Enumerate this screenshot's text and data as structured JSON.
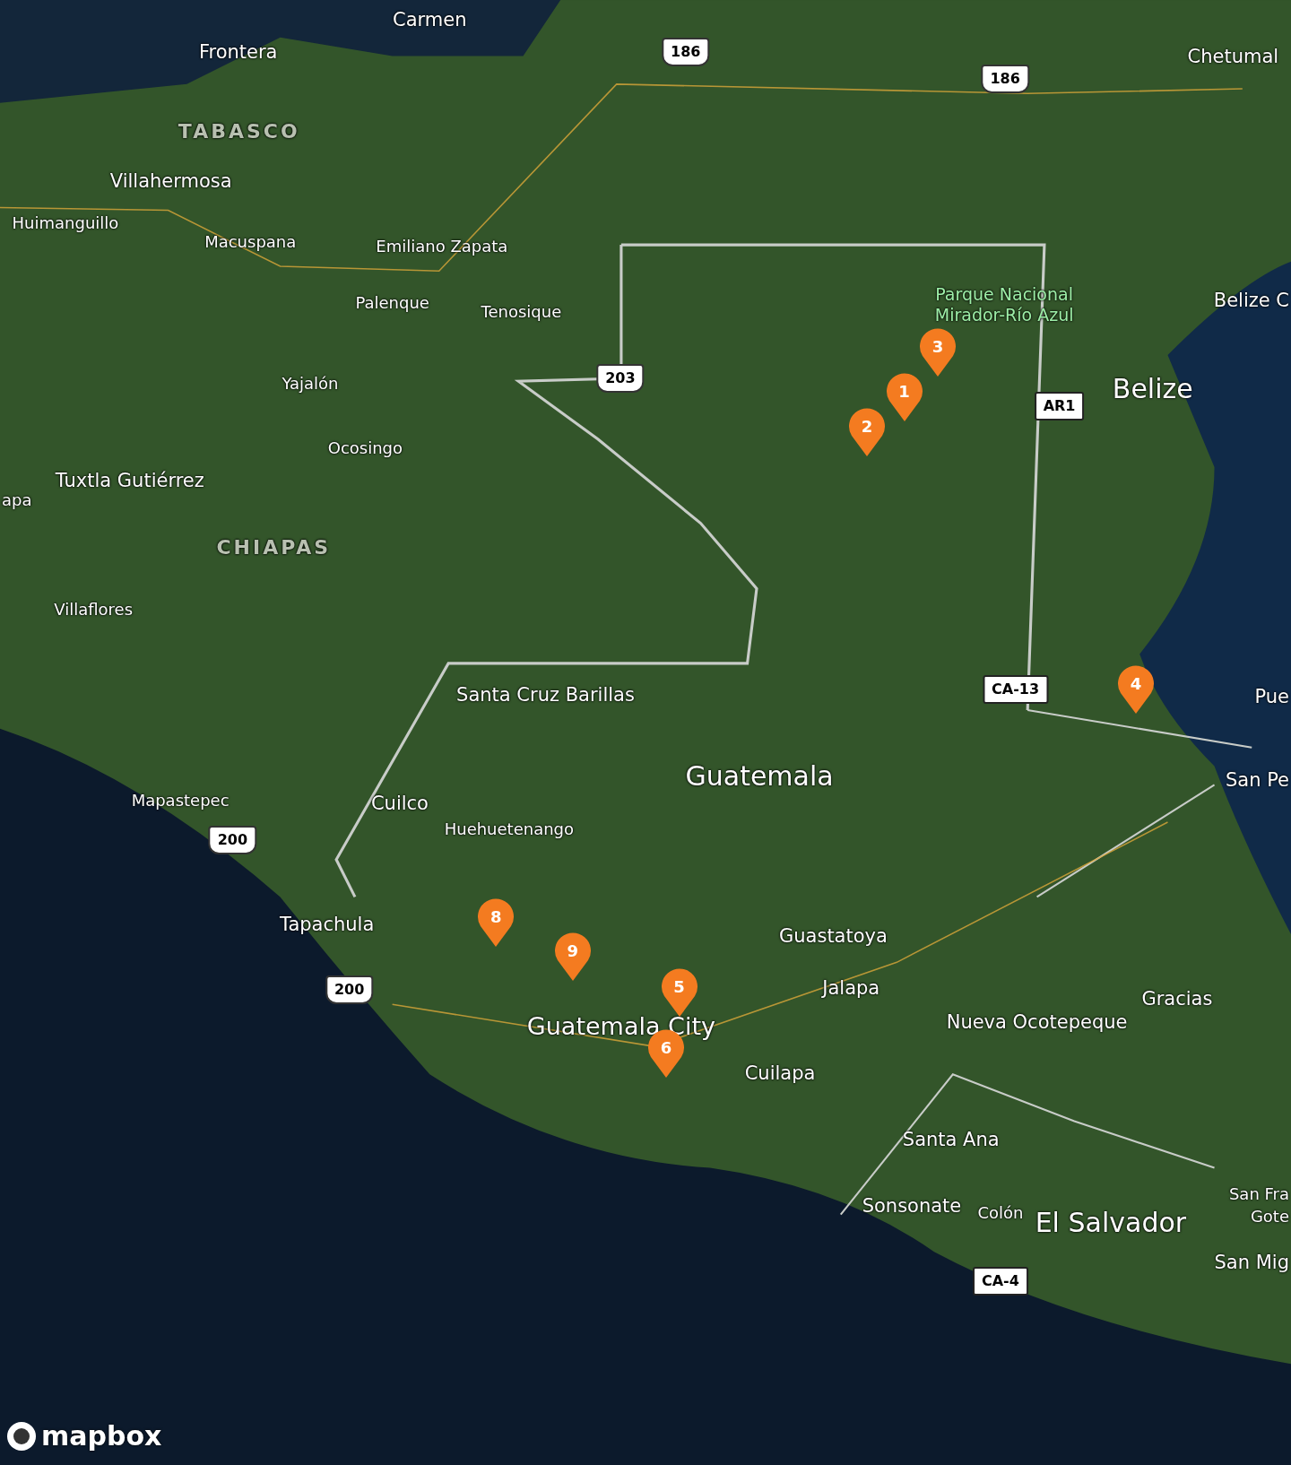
{
  "map": {
    "labels": [
      {
        "text": "Carmen",
        "kind": "city"
      },
      {
        "text": "Frontera",
        "kind": "city"
      },
      {
        "text": "Chetumal",
        "kind": "city"
      },
      {
        "text": "TABASCO",
        "kind": "region"
      },
      {
        "text": "Villahermosa",
        "kind": "city"
      },
      {
        "text": "Huimanguillo",
        "kind": "town"
      },
      {
        "text": "Macuspana",
        "kind": "town"
      },
      {
        "text": "Emiliano Zapata",
        "kind": "town"
      },
      {
        "text": "Palenque",
        "kind": "town"
      },
      {
        "text": "Tenosique",
        "kind": "town"
      },
      {
        "text": "Yajalón",
        "kind": "town"
      },
      {
        "text": "Ocosingo",
        "kind": "town"
      },
      {
        "text": "Tuxtla Gutiérrez",
        "kind": "city"
      },
      {
        "text": "apa",
        "kind": "town"
      },
      {
        "text": "CHIAPAS",
        "kind": "region"
      },
      {
        "text": "Villaflores",
        "kind": "town"
      },
      {
        "text": "Parque Nacional Mirador-Río Azul",
        "kind": "park"
      },
      {
        "text": "Belize C",
        "kind": "city"
      },
      {
        "text": "Belize",
        "kind": "country"
      },
      {
        "text": "Santa Cruz Barillas",
        "kind": "city"
      },
      {
        "text": "Guatemala",
        "kind": "country"
      },
      {
        "text": "Pue",
        "kind": "city"
      },
      {
        "text": "San Pe",
        "kind": "city"
      },
      {
        "text": "Mapastepec",
        "kind": "town"
      },
      {
        "text": "Cuilco",
        "kind": "city"
      },
      {
        "text": "Huehuetenango",
        "kind": "town"
      },
      {
        "text": "Tapachula",
        "kind": "city"
      },
      {
        "text": "Guastatoya",
        "kind": "city"
      },
      {
        "text": "Jalapa",
        "kind": "city"
      },
      {
        "text": "Nueva Ocotepeque",
        "kind": "city"
      },
      {
        "text": "Gracias",
        "kind": "city"
      },
      {
        "text": "Guatemala City",
        "kind": "capital"
      },
      {
        "text": "Cuilapa",
        "kind": "city"
      },
      {
        "text": "Santa Ana",
        "kind": "city"
      },
      {
        "text": "Sonsonate",
        "kind": "city"
      },
      {
        "text": "Colón",
        "kind": "town"
      },
      {
        "text": "El Salvador",
        "kind": "country"
      },
      {
        "text": "San Fra",
        "kind": "town"
      },
      {
        "text": "Gote",
        "kind": "town"
      },
      {
        "text": "San Mig",
        "kind": "city"
      }
    ],
    "shields": [
      {
        "text": "186",
        "kind": "federal"
      },
      {
        "text": "186",
        "kind": "federal"
      },
      {
        "text": "203",
        "kind": "federal"
      },
      {
        "text": "200",
        "kind": "federal"
      },
      {
        "text": "200",
        "kind": "federal"
      },
      {
        "text": "AR1",
        "kind": "box"
      },
      {
        "text": "CA-13",
        "kind": "box"
      },
      {
        "text": "CA-4",
        "kind": "box"
      }
    ],
    "markers": [
      "3",
      "1",
      "2",
      "4",
      "8",
      "9",
      "5",
      "6"
    ],
    "attribution": "mapbox"
  }
}
